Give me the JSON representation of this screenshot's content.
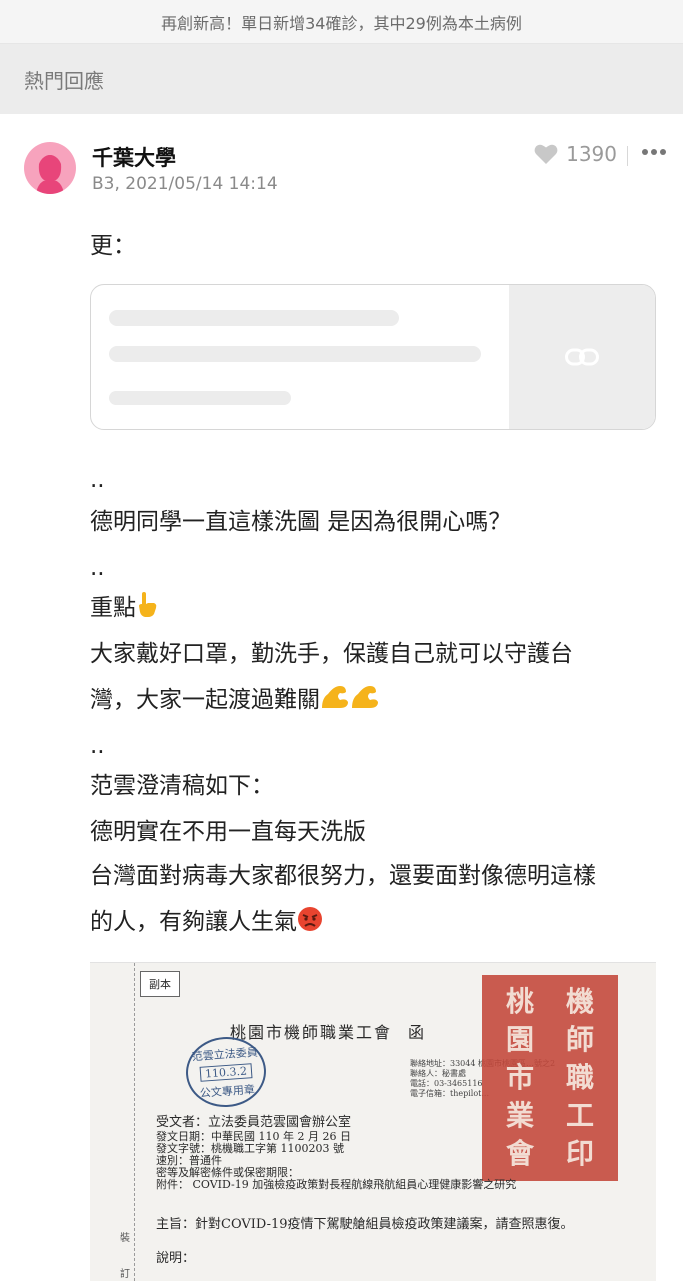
{
  "banner": {
    "text": "再創新高！單日新增34確診，其中29例為本土病例"
  },
  "section": {
    "title": "熱門回應"
  },
  "post": {
    "author": "千葉大學",
    "meta": "B3, 2021/05/14 14:14",
    "likes": "1390",
    "lines": [
      "更：",
      "..",
      "德明同學一直這樣洗圖 是因為很開心嗎？",
      "..",
      "重點",
      "大家戴好口罩，勤洗手，保護自己就可以守護台",
      "灣，大家一起渡過難關",
      "..",
      "范雲澄清稿如下：",
      "德明實在不用一直每天洗版",
      "台灣面對病毒大家都很努力，還要面對像德明這樣",
      "的人，有夠讓人生氣"
    ]
  },
  "icons": {
    "avatar": "female-avatar-icon",
    "like": "heart-icon",
    "more": "more-icon",
    "link": "link-icon",
    "point_down": "point-down-emoji",
    "muscle": "muscle-emoji",
    "angry": "angry-emoji"
  },
  "document": {
    "copy_label": "副本",
    "title": "桃園市機師職業工會",
    "suffix": "函",
    "contact": [
      "聯絡地址：33044 桃園市桃園區…號之2",
      "聯絡人：秘書處",
      "電話：03-3465116",
      "電子信箱：thepilot..."
    ],
    "stamp_top": "范雲立法委員",
    "stamp_date": "110.3.2",
    "stamp_bottom": "公文專用章",
    "seal_chars": [
      "桃",
      "機",
      "園",
      "師",
      "市",
      "職",
      "業",
      "工",
      "會",
      "印"
    ],
    "recipient": "受文者：立法委員范雲國會辦公室",
    "details": [
      "發文日期：中華民國 110 年 2 月 26 日",
      "發文字號：桃機職工字第 1100203 號",
      "速別：普通件",
      "密等及解密條件或保密期限：",
      "附件： COVID-19 加強檢疫政策對長程航線飛航組員心理健康影響之研究"
    ],
    "subject": "主旨：針對COVID-19疫情下駕駛艙組員檢疫政策建議案，請查照惠復。",
    "desc": "說明：",
    "side_1": "裝",
    "side_2": "訂"
  },
  "colors": {
    "accent_avatar": "#f7a3bd",
    "seal_red": "#c4473a",
    "stamp_blue": "#3d5a86"
  }
}
